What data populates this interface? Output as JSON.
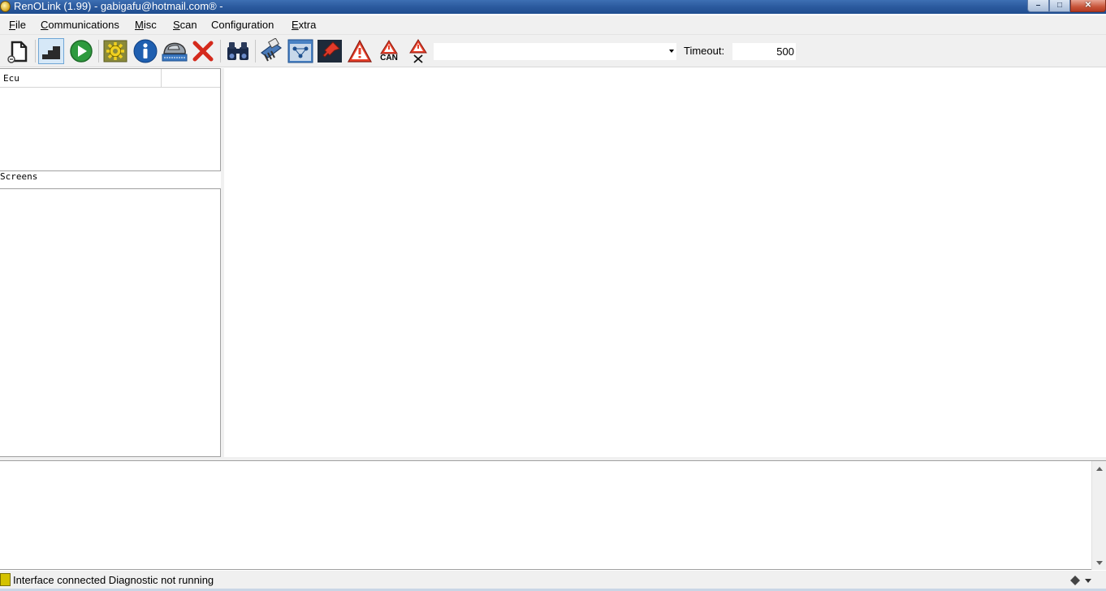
{
  "window": {
    "title": "RenOLink (1.99) - gabigafu@hotmail.com® -",
    "controls": {
      "minimize": "–",
      "maximize": "□",
      "close": "✕"
    }
  },
  "menu": {
    "items": [
      {
        "first": "F",
        "rest": "ile"
      },
      {
        "first": "C",
        "rest": "ommunications"
      },
      {
        "first": "M",
        "rest": "isc"
      },
      {
        "first": "S",
        "rest": "can"
      },
      {
        "first": "",
        "rest": "Configuration"
      },
      {
        "first": "E",
        "rest": "xtra"
      }
    ]
  },
  "toolbar": {
    "icons": [
      "document-icon",
      "connect-icon",
      "play-icon",
      "settings-gear-icon",
      "info-icon",
      "car-scan-icon",
      "close-x-icon",
      "binoculars-icon",
      "ecu-flash-icon",
      "network-icon",
      "pin-icon",
      "warning-icon",
      "can-warning-icon",
      "clear-warning-icon"
    ],
    "can_label": "CAN",
    "combo_value": "",
    "timeout_label": "Timeout:",
    "timeout_value": "500"
  },
  "ecu_panel": {
    "column_header": "Ecu"
  },
  "screens_panel": {
    "label": "Screens"
  },
  "status": {
    "text": "Interface connected Diagnostic not running"
  }
}
